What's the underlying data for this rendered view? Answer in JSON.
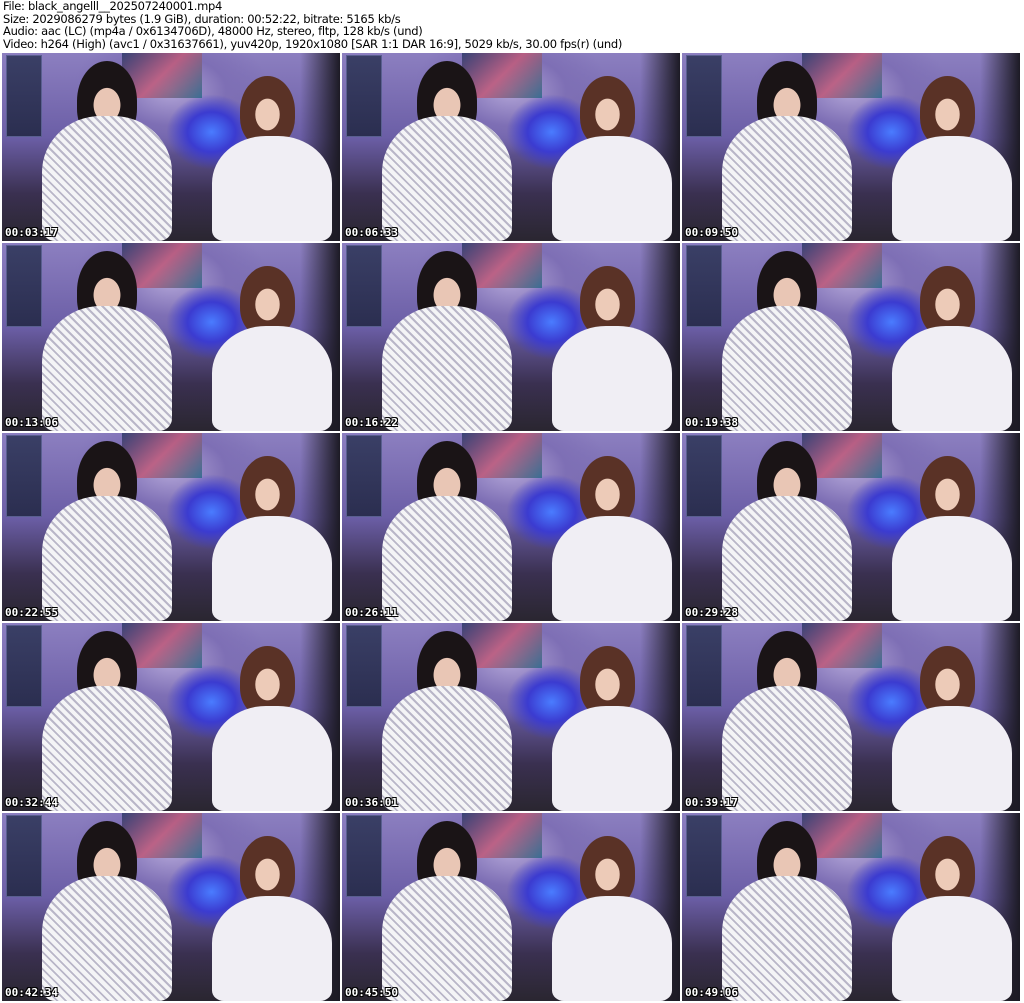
{
  "header": {
    "file": "File: black_angelll__202507240001.mp4",
    "size": "Size: 2029086279 bytes (1.9 GiB), duration: 00:52:22, bitrate: 5165 kb/s",
    "audio": "Audio: aac (LC) (mp4a / 0x6134706D), 48000 Hz, stereo, fltp, 128 kb/s (und)",
    "video": "Video: h264 (High) (avc1 / 0x31637661), yuv420p, 1920x1080 [SAR 1:1 DAR 16:9], 5029 kb/s, 30.00 fps(r) (und)"
  },
  "thumbnails": [
    {
      "timestamp": "00:03:17"
    },
    {
      "timestamp": "00:06:33"
    },
    {
      "timestamp": "00:09:50"
    },
    {
      "timestamp": "00:13:06"
    },
    {
      "timestamp": "00:16:22"
    },
    {
      "timestamp": "00:19:38"
    },
    {
      "timestamp": "00:22:55"
    },
    {
      "timestamp": "00:26:11"
    },
    {
      "timestamp": "00:29:28"
    },
    {
      "timestamp": "00:32:44"
    },
    {
      "timestamp": "00:36:01"
    },
    {
      "timestamp": "00:39:17"
    },
    {
      "timestamp": "00:42:34"
    },
    {
      "timestamp": "00:45:50"
    },
    {
      "timestamp": "00:49:06"
    }
  ]
}
